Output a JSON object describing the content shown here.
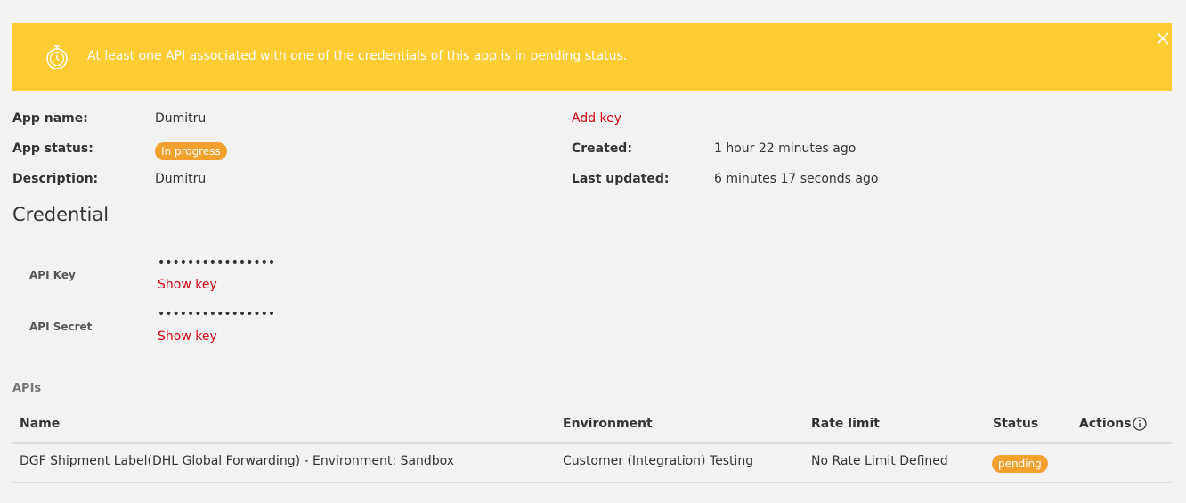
{
  "alert": {
    "message": "At least one API associated with one of the credentials of this app is in pending status.",
    "icon": "timer-icon",
    "close_icon": "close-icon",
    "color": "#ffcc33"
  },
  "app_info": {
    "app_name_label": "App name:",
    "app_name_value": "Dumitru",
    "app_status_label": "App status:",
    "app_status_value": "In progress",
    "description_label": "Description:",
    "description_value": "Dumitru",
    "add_key_label": "Add key",
    "created_label": "Created:",
    "created_value": "1 hour 22 minutes ago",
    "last_updated_label": "Last updated:",
    "last_updated_value": "6 minutes 17 seconds ago"
  },
  "credential": {
    "title": "Credential",
    "api_key_label": "API Key",
    "api_key_masked": "••••••••••••••••",
    "api_key_show": "Show key",
    "api_secret_label": "API Secret",
    "api_secret_masked": "••••••••••••••••",
    "api_secret_show": "Show key"
  },
  "apis": {
    "title": "APIs",
    "columns": [
      "Name",
      "Environment",
      "Rate limit",
      "Status",
      "Actions"
    ],
    "rows": [
      {
        "name": "DGF Shipment Label(DHL Global Forwarding) - Environment: Sandbox",
        "environment": "Customer (Integration) Testing",
        "rate_limit": "No Rate Limit Defined",
        "status": "pending"
      }
    ]
  },
  "colors": {
    "link": "#d40511",
    "badge": "#f2a12e"
  }
}
